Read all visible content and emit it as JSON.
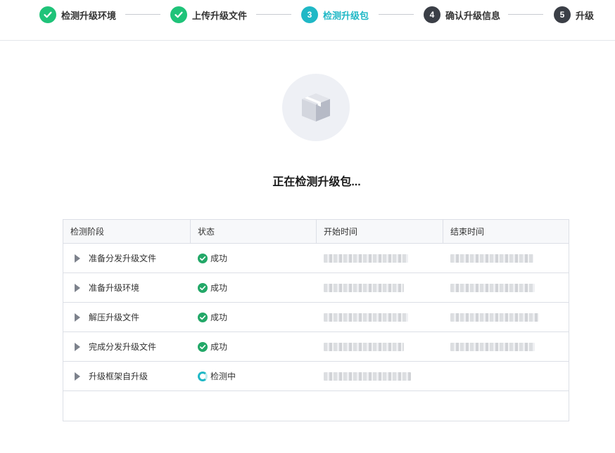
{
  "stepper": {
    "steps": [
      {
        "number": "",
        "label": "检测升级环境",
        "state": "done"
      },
      {
        "number": "",
        "label": "上传升级文件",
        "state": "done"
      },
      {
        "number": "3",
        "label": "检测升级包",
        "state": "active"
      },
      {
        "number": "4",
        "label": "确认升级信息",
        "state": "pending"
      },
      {
        "number": "5",
        "label": "升级",
        "state": "pending"
      }
    ],
    "colors": {
      "done": "#1fc379",
      "active": "#20b8c6",
      "pending": "#3b3f47"
    }
  },
  "main": {
    "icon": "package-box-icon",
    "title": "正在检测升级包..."
  },
  "table": {
    "headers": [
      "检测阶段",
      "状态",
      "开始时间",
      "结束时间"
    ],
    "rows": [
      {
        "stage": "准备分发升级文件",
        "status": "成功",
        "state": "success"
      },
      {
        "stage": "准备升级环境",
        "status": "成功",
        "state": "success"
      },
      {
        "stage": "解压升级文件",
        "status": "成功",
        "state": "success"
      },
      {
        "stage": "完成分发升级文件",
        "status": "成功",
        "state": "success"
      },
      {
        "stage": "升级框架自升级",
        "status": "检测中",
        "state": "checking"
      }
    ],
    "colors": {
      "success": "#23a868",
      "checking": "#20b8c6"
    }
  }
}
